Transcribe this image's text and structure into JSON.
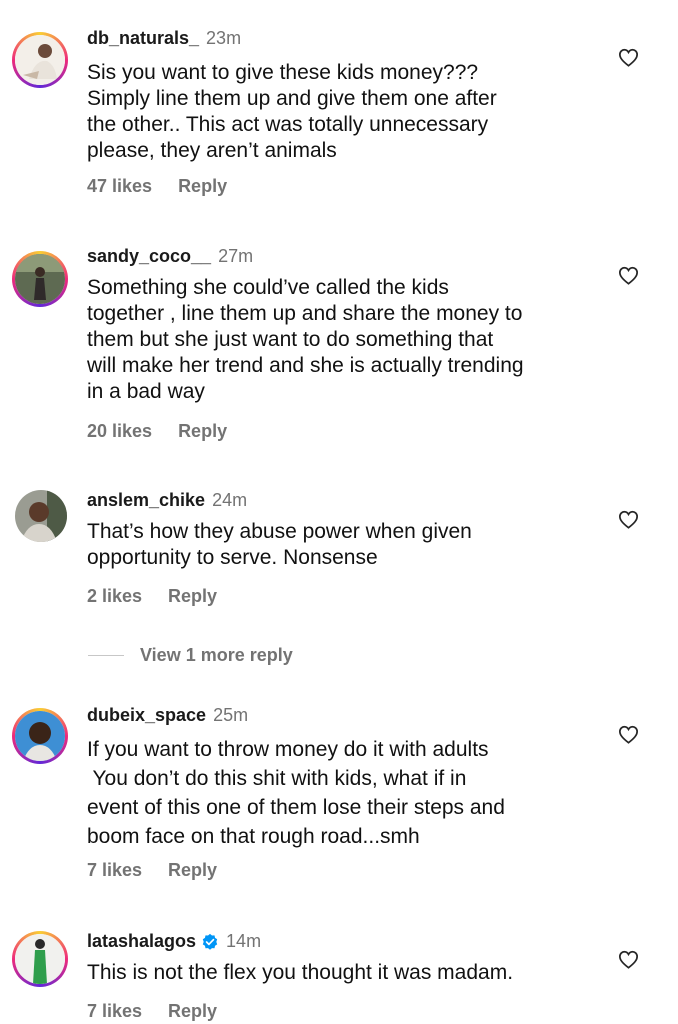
{
  "comments": [
    {
      "username": "db_naturals_",
      "time": "23m",
      "lines": [
        "Sis you want to give these kids money???",
        "Simply line them up and give them one after",
        "the other.. This act was totally unnecessary",
        "please, they aren’t animals"
      ],
      "likes": "47 likes",
      "reply": "Reply"
    },
    {
      "username": "sandy_coco__",
      "time": "27m",
      "lines": [
        "Something she could’ve called the kids",
        "together , line them up and share the money to",
        "them but she just want to do something that",
        "will make her trend and she is actually trending",
        "in a bad way"
      ],
      "likes": "20 likes",
      "reply": "Reply"
    },
    {
      "username": "anslem_chike",
      "time": "24m",
      "lines": [
        "That’s how they abuse power when given",
        "opportunity to serve. Nonsense"
      ],
      "likes": "2 likes",
      "reply": "Reply"
    },
    {
      "username": "dubeix_space",
      "time": "25m",
      "lines": [
        "If you want to throw money do it with adults",
        " You don’t do this shit with kids, what if in",
        "event of this one of them lose their steps and",
        "boom face on that rough road...smh"
      ],
      "likes": "7 likes",
      "reply": "Reply"
    },
    {
      "username": "latashalagos",
      "time": "14m",
      "lines": [
        "This is not the flex you thought it was madam."
      ],
      "likes": "7 likes",
      "reply": "Reply"
    }
  ],
  "view_more_replies": "View 1 more reply",
  "colors": {
    "secondary_text": "#737373",
    "verified_badge": "#0095f6",
    "story_ring": [
      "#f9ce34",
      "#ee2a7b",
      "#6228d7"
    ]
  },
  "icons": {
    "like": "heart-outline-icon",
    "verified": "verified-badge-icon"
  }
}
